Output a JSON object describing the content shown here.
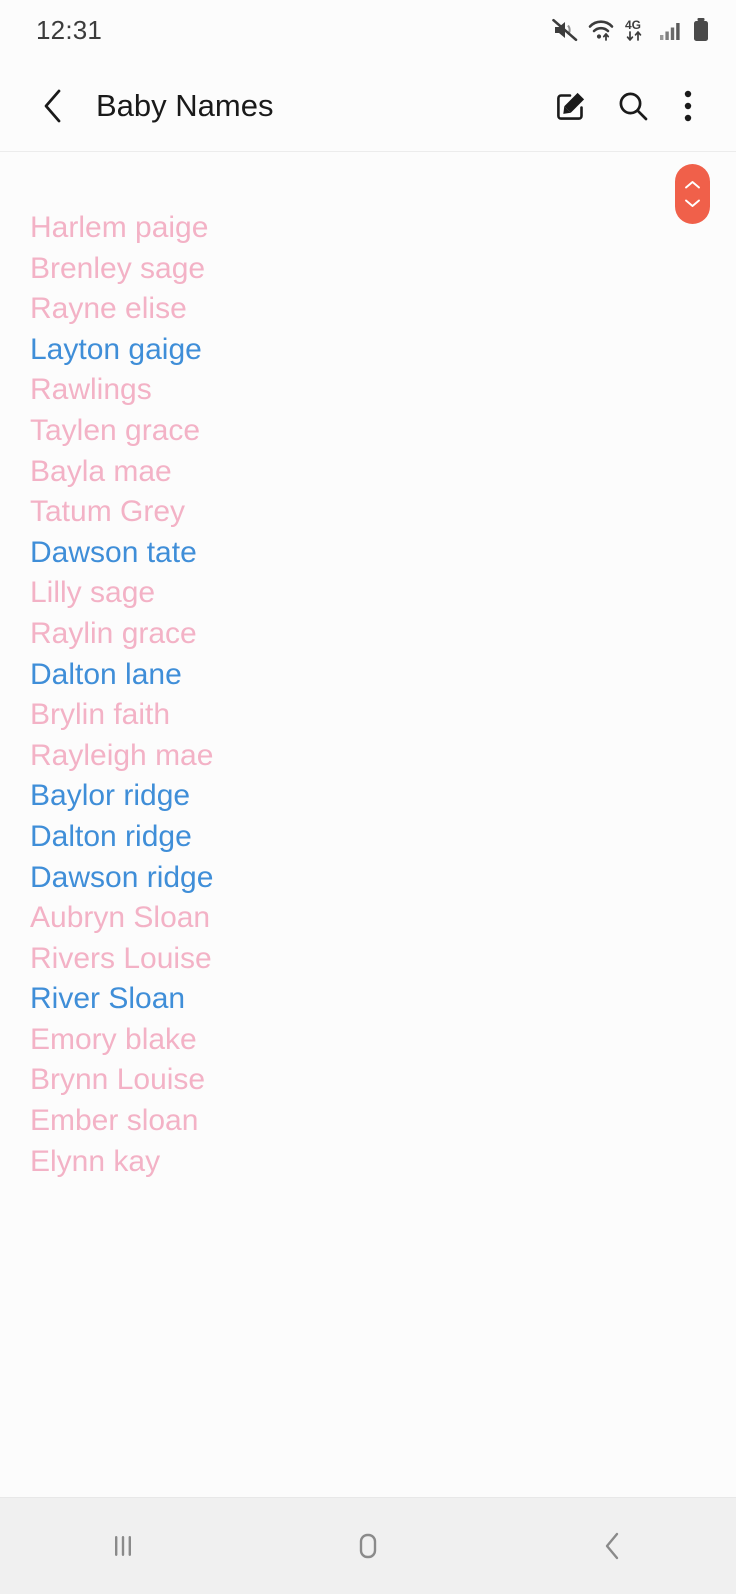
{
  "status_bar": {
    "time": "12:31",
    "icons": [
      {
        "name": "mute-icon",
        "label": "Sound muted"
      },
      {
        "name": "wifi-icon",
        "label": "Wi-Fi connected"
      },
      {
        "name": "network-4g-icon",
        "label": "4G"
      },
      {
        "name": "signal-bars-icon",
        "label": "Cellular signal"
      },
      {
        "name": "battery-icon",
        "label": "Battery"
      }
    ]
  },
  "app_bar": {
    "back_label": "Back",
    "title": "Baby Names",
    "actions": [
      {
        "name": "compose-button",
        "label": "Edit"
      },
      {
        "name": "search-button",
        "label": "Search"
      },
      {
        "name": "overflow-button",
        "label": "More options"
      }
    ]
  },
  "colors": {
    "pink": "#f3b2c6",
    "blue": "#3f8ed8",
    "scroll_thumb": "#f0604a",
    "background": "#fcfcfc",
    "nav_background": "#f0f0f0",
    "title": "#1a1a1a"
  },
  "scroll_thumb": {
    "name": "fast-scroll-thumb",
    "up_label": "Scroll up",
    "down_label": "Scroll down"
  },
  "note": {
    "lines": [
      {
        "text": "Harlem paige",
        "color": "pink"
      },
      {
        "text": "Brenley sage",
        "color": "pink"
      },
      {
        "text": "Rayne elise",
        "color": "pink"
      },
      {
        "text": "Layton gaige",
        "color": "blue"
      },
      {
        "text": "Rawlings",
        "color": "pink"
      },
      {
        "text": "Taylen grace",
        "color": "pink"
      },
      {
        "text": "Bayla mae",
        "color": "pink"
      },
      {
        "text": "Tatum Grey",
        "color": "pink"
      },
      {
        "text": "Dawson tate",
        "color": "blue"
      },
      {
        "text": "Lilly sage",
        "color": "pink"
      },
      {
        "text": "Raylin grace",
        "color": "pink"
      },
      {
        "text": "Dalton lane",
        "color": "blue"
      },
      {
        "text": "Brylin faith",
        "color": "pink"
      },
      {
        "text": "Rayleigh mae",
        "color": "pink"
      },
      {
        "text": "Baylor ridge",
        "color": "blue"
      },
      {
        "text": "Dalton ridge",
        "color": "blue"
      },
      {
        "text": "Dawson ridge",
        "color": "blue"
      },
      {
        "text": "Aubryn Sloan",
        "color": "pink"
      },
      {
        "text": "Rivers Louise",
        "color": "pink"
      },
      {
        "text": "River Sloan",
        "color": "blue"
      },
      {
        "text": "Emory blake",
        "color": "pink"
      },
      {
        "text": "Brynn Louise",
        "color": "pink"
      },
      {
        "text": "Ember sloan",
        "color": "pink"
      },
      {
        "text": "Elynn kay",
        "color": "pink"
      }
    ]
  },
  "nav_bar": {
    "keys": [
      {
        "name": "recents-key",
        "label": "Recents"
      },
      {
        "name": "home-key",
        "label": "Home"
      },
      {
        "name": "back-key",
        "label": "Back"
      }
    ]
  }
}
